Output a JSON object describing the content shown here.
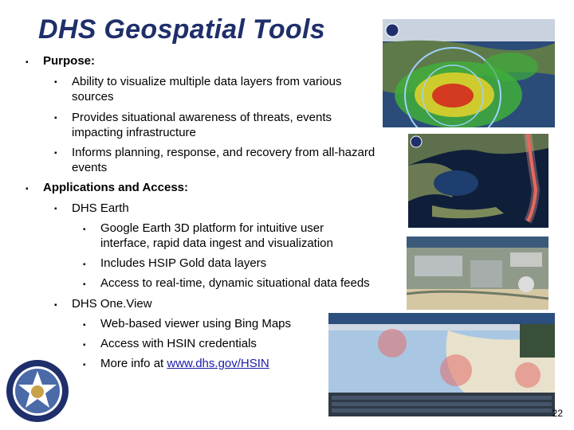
{
  "slide": {
    "title": "DHS Geospatial Tools",
    "page_number": "22"
  },
  "purpose": {
    "heading": "Purpose:",
    "items": [
      "Ability to visualize multiple data layers from various sources",
      "Provides situational awareness of threats, events impacting infrastructure",
      "Informs planning, response, and recovery from all-hazard events"
    ]
  },
  "applications": {
    "heading": "Applications and Access:",
    "earth": {
      "label": "DHS Earth",
      "items": [
        "Google Earth 3D platform for intuitive user interface, rapid data ingest and visualization",
        "Includes HSIP Gold data layers",
        "Access to real-time, dynamic situational data feeds"
      ]
    },
    "oneview": {
      "label": "DHS One.View",
      "items": [
        "Web-based viewer using Bing Maps",
        "Access with HSIN credentials"
      ],
      "more_info_prefix": "More info at ",
      "more_info_link": "www.dhs.gov/HSIN"
    }
  },
  "images": {
    "colors": {
      "accent": "#1f2f6b",
      "link": "#1a1aa8",
      "ocean": "#1d3e6e",
      "radar_green": "#3fae3a",
      "storm_red": "#d42a1e"
    }
  }
}
